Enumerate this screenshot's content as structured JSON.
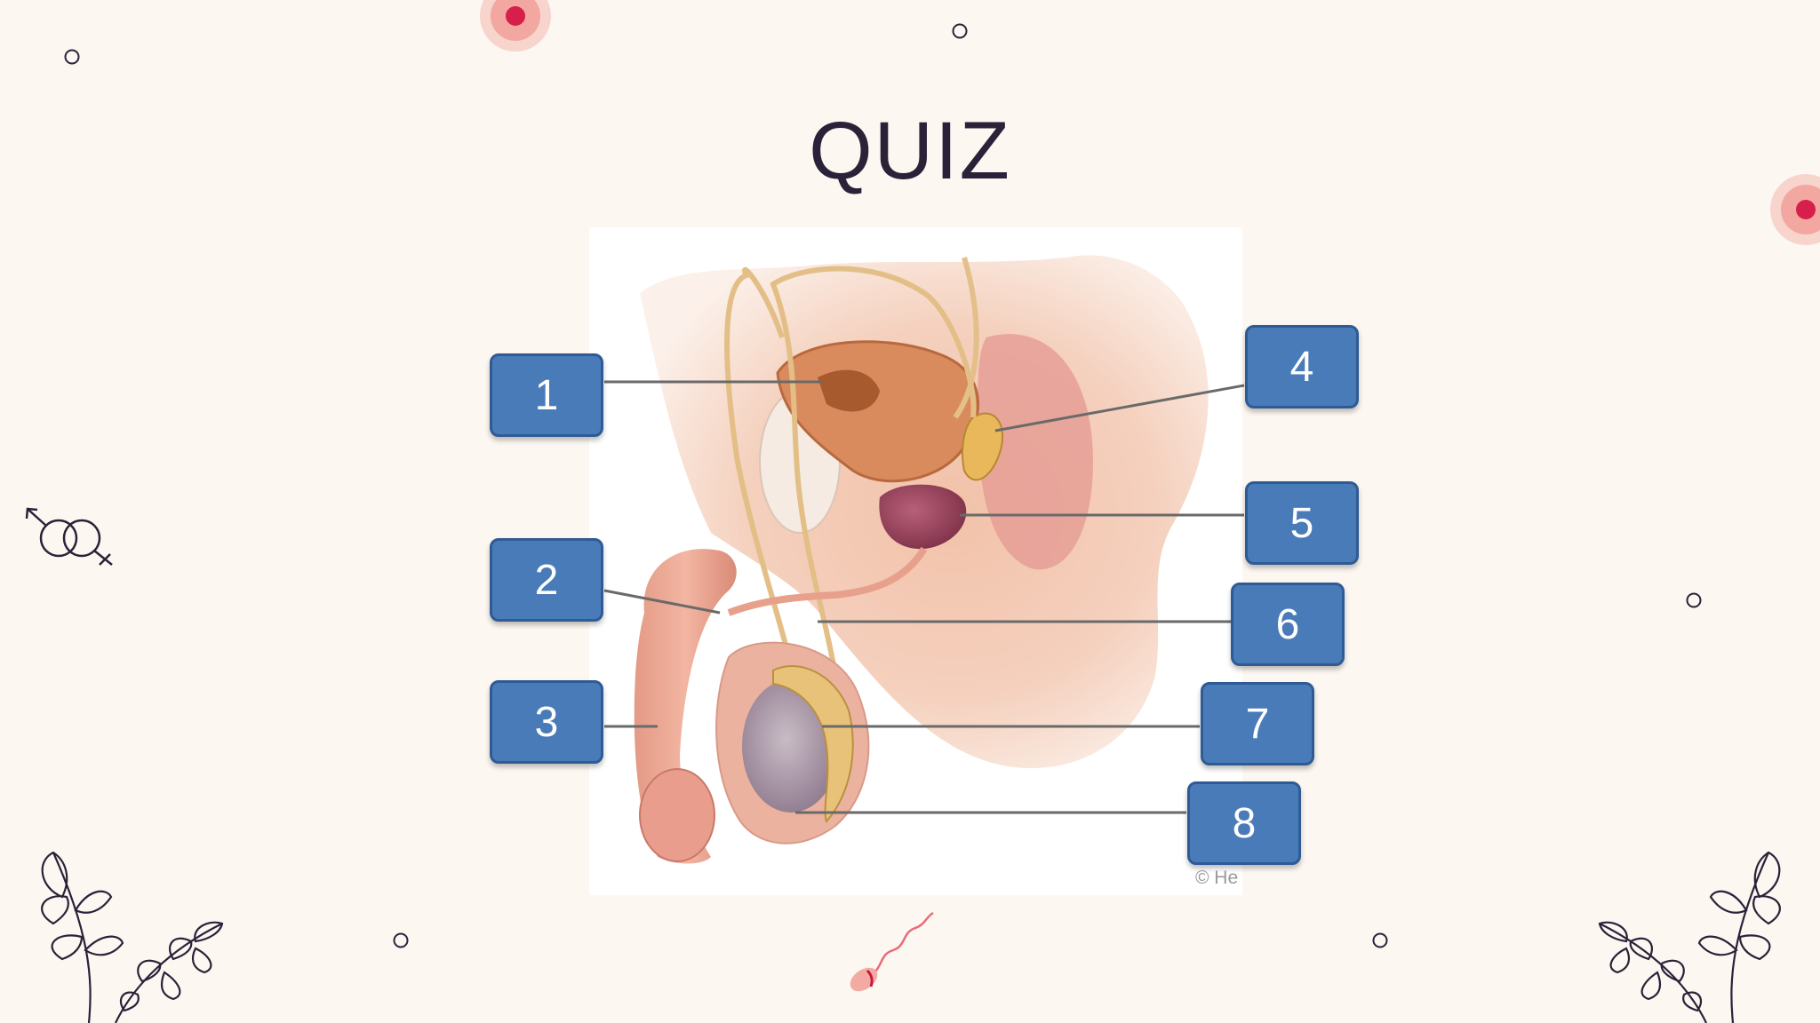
{
  "slide": {
    "title": "QUIZ",
    "copyright": "© He"
  },
  "labels": [
    "1",
    "2",
    "3",
    "4",
    "5",
    "6",
    "7",
    "8"
  ],
  "colors": {
    "background": "#fdf7f1",
    "title": "#2a2239",
    "label_fill": "#4a7bb9",
    "label_border": "#2f5b95",
    "accent_pink": "#f2a7a0",
    "accent_red": "#d61f4a"
  },
  "decorations": [
    "target-dot-icon",
    "ring-icon",
    "gender-symbol-icon",
    "leaf-branch-icon",
    "sperm-icon"
  ]
}
